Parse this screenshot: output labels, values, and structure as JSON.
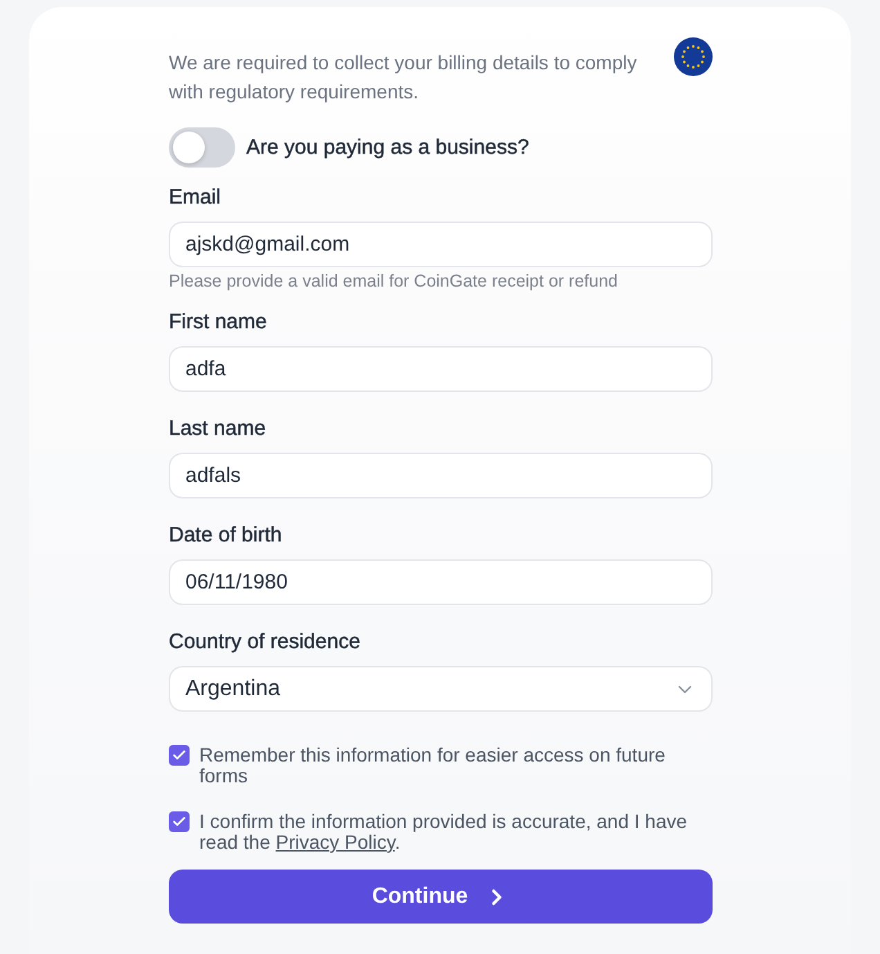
{
  "notice": {
    "text": "We are required to collect your billing details to comply with regulatory requirements."
  },
  "business_toggle": {
    "label": "Are you paying as a business?",
    "on": false
  },
  "fields": [
    {
      "kind": "text",
      "label": "Email",
      "value": "ajskd@gmail.com",
      "helper": "Please provide a valid email for CoinGate receipt or refund"
    },
    {
      "kind": "text",
      "label": "First name",
      "value": "adfa"
    },
    {
      "kind": "text",
      "label": "Last name",
      "value": "adfals"
    },
    {
      "kind": "text",
      "label": "Date of birth",
      "value": "06/11/1980"
    },
    {
      "kind": "select",
      "label": "Country of residence",
      "value": "Argentina"
    }
  ],
  "checkboxes": [
    {
      "text": "Remember this information for easier access on future forms",
      "checked": true
    },
    {
      "text": "I confirm the information provided is accurate, and I have read the ",
      "link": "Privacy Policy",
      "suffix": ".",
      "checked": true
    }
  ],
  "button": {
    "label": "Continue"
  }
}
